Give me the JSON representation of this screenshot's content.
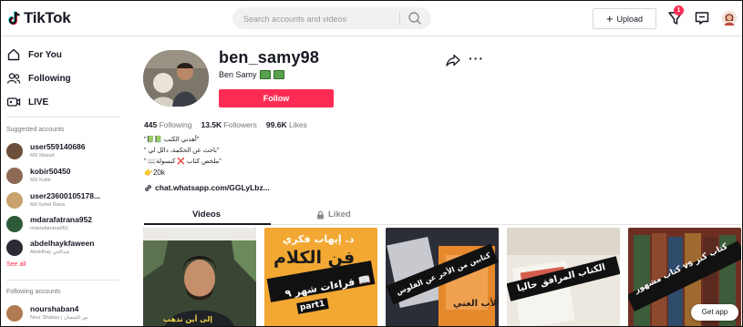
{
  "header": {
    "logo_text": "TikTok",
    "search_placeholder": "Search accounts and videos",
    "upload_label": "Upload",
    "inbox_badge": "1"
  },
  "sidebar": {
    "nav": [
      {
        "label": "For You",
        "icon": "home-icon"
      },
      {
        "label": "Following",
        "icon": "following-icon"
      },
      {
        "label": "LIVE",
        "icon": "live-icon"
      }
    ],
    "suggested_heading": "Suggested accounts",
    "suggested": [
      {
        "name": "user559140686",
        "sub": "MD Masud"
      },
      {
        "name": "kobir50450",
        "sub": "MD Kobir"
      },
      {
        "name": "user23600105178...",
        "sub": "Md Sohel Rana"
      },
      {
        "name": "mdarafatrana952",
        "sub": "mdarafatrana952"
      },
      {
        "name": "abdelhaykfaween",
        "sub": "Abdelhay عبدالحي"
      }
    ],
    "see_all": "See all",
    "following_heading": "Following accounts",
    "following": [
      {
        "name": "nourshaban4",
        "sub": "Nour Shaban | نور الشعبان"
      }
    ]
  },
  "profile": {
    "username": "ben_samy98",
    "display_name": "Ben Samy",
    "follow_label": "Follow",
    "stats": {
      "following_count": "445",
      "following_label": "Following",
      "followers_count": "13.5K",
      "followers_label": "Followers",
      "likes_count": "99.6K",
      "likes_label": "Likes"
    },
    "bio": [
      "\"📗📗 أهدني الكتب\"",
      "\" باحث عن الحكمة، دالل لي\"",
      "\" 📖ملخص كتاب ❌ كبسولة\"",
      "👉20k"
    ],
    "link": "chat.whatsapp.com/GGLyLbz..."
  },
  "tabs": {
    "videos": "Videos",
    "liked": "Liked"
  },
  "videos": [
    {
      "caption": "إلى أين تذهب"
    },
    {
      "caption_top": "د. إيهاب فكري",
      "caption_mid": "فن الكلام",
      "caption_band": "قراءات شهر ٩ 📖",
      "caption_part": "part1"
    },
    {
      "caption": "كتابين من الأخر عن الفلوس",
      "book_text": "الأب الغني"
    },
    {
      "caption": "الكتاب المرافق حاليا"
    },
    {
      "caption": "كتاب مشهور vs كتاب كنز"
    }
  ],
  "get_app_label": "Get app",
  "colors": {
    "accent": "#fe2c55",
    "text": "#161823",
    "muted": "#75767c"
  }
}
